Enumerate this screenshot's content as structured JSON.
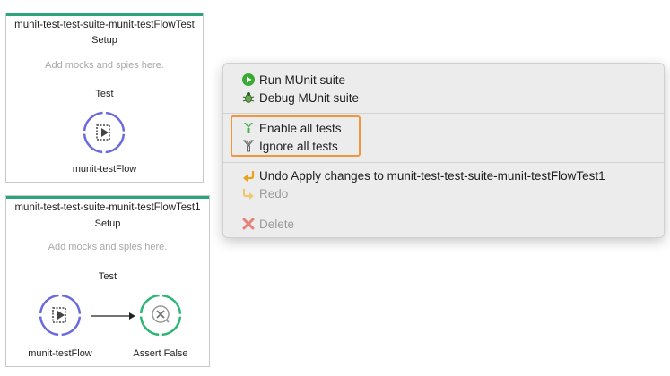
{
  "cards": [
    {
      "title": "munit-test-test-suite-munit-testFlowTest",
      "setup": "Setup",
      "hint": "Add mocks and spies here.",
      "test": "Test",
      "flow_label": "munit-testFlow"
    },
    {
      "title": "munit-test-test-suite-munit-testFlowTest1",
      "setup": "Setup",
      "hint": "Add mocks and spies here.",
      "test": "Test",
      "flow_label": "munit-testFlow",
      "assert_label": "Assert False"
    }
  ],
  "menu": {
    "run": "Run MUnit suite",
    "debug": "Debug MUnit suite",
    "enable": "Enable all tests",
    "ignore": "Ignore all tests",
    "undo": "Undo Apply changes to munit-test-test-suite-munit-testFlowTest1",
    "redo": "Redo",
    "delete": "Delete"
  },
  "colors": {
    "accent_green": "#2aa57a",
    "flow_purple": "#6a6adf",
    "highlight_orange": "#f0963c"
  }
}
